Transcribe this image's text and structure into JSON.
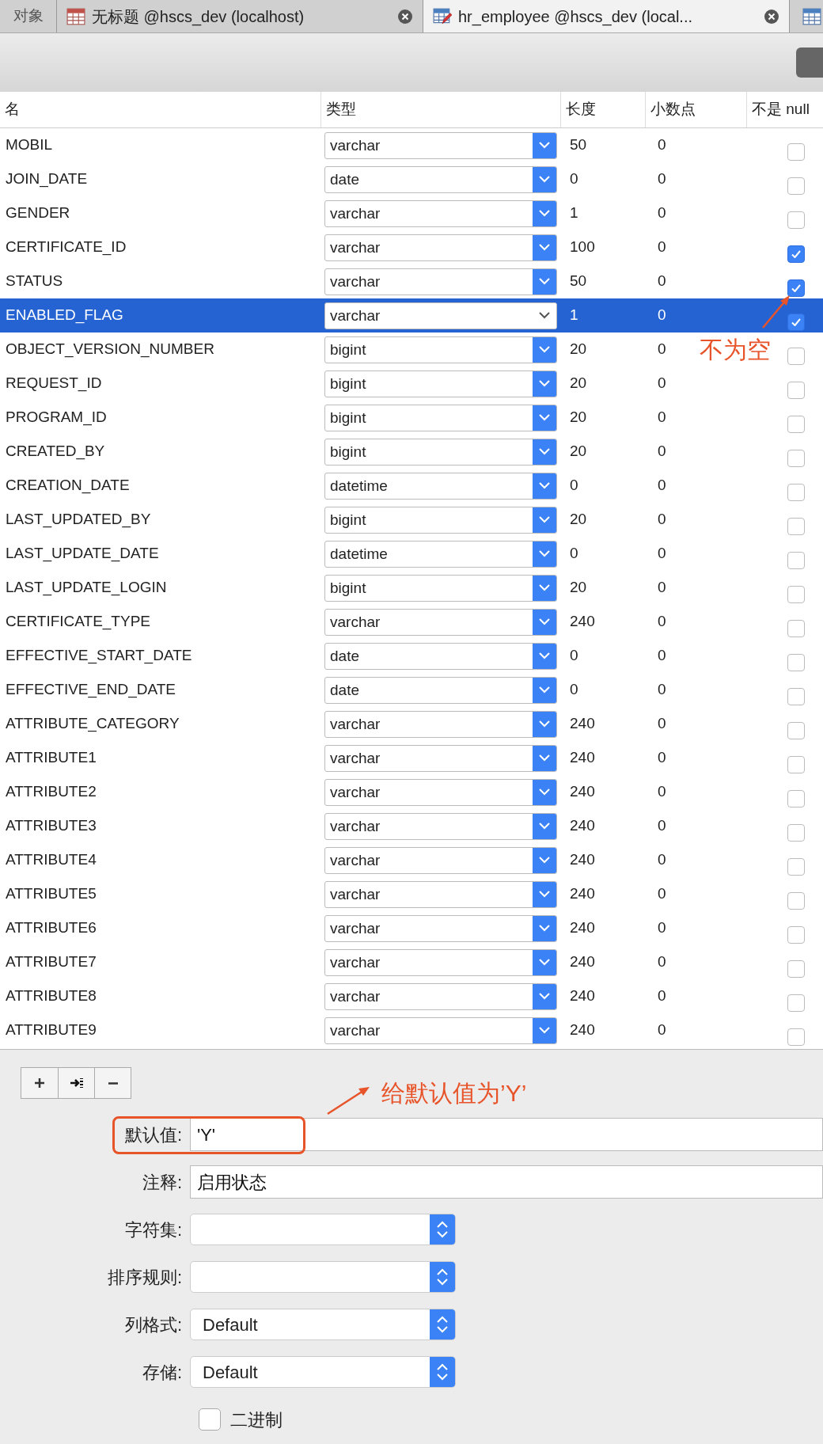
{
  "object_tab": {
    "label": "对象"
  },
  "tabs": [
    {
      "label": "无标题 @hscs_dev (localhost)",
      "selected": false
    },
    {
      "label": "hr_employee @hscs_dev (local...",
      "selected": true
    }
  ],
  "table": {
    "columns": [
      "名",
      "类型",
      "长度",
      "小数点",
      "不是 null"
    ],
    "rows": [
      {
        "name": "MOBIL",
        "type": "varchar",
        "length": "50",
        "decimals": "0",
        "not_null": false,
        "selected": false
      },
      {
        "name": "JOIN_DATE",
        "type": "date",
        "length": "0",
        "decimals": "0",
        "not_null": false,
        "selected": false
      },
      {
        "name": "GENDER",
        "type": "varchar",
        "length": "1",
        "decimals": "0",
        "not_null": false,
        "selected": false
      },
      {
        "name": "CERTIFICATE_ID",
        "type": "varchar",
        "length": "100",
        "decimals": "0",
        "not_null": true,
        "selected": false
      },
      {
        "name": "STATUS",
        "type": "varchar",
        "length": "50",
        "decimals": "0",
        "not_null": true,
        "selected": false
      },
      {
        "name": "ENABLED_FLAG",
        "type": "varchar",
        "length": "1",
        "decimals": "0",
        "not_null": true,
        "selected": true
      },
      {
        "name": "OBJECT_VERSION_NUMBER",
        "type": "bigint",
        "length": "20",
        "decimals": "0",
        "not_null": false,
        "selected": false
      },
      {
        "name": "REQUEST_ID",
        "type": "bigint",
        "length": "20",
        "decimals": "0",
        "not_null": false,
        "selected": false
      },
      {
        "name": "PROGRAM_ID",
        "type": "bigint",
        "length": "20",
        "decimals": "0",
        "not_null": false,
        "selected": false
      },
      {
        "name": "CREATED_BY",
        "type": "bigint",
        "length": "20",
        "decimals": "0",
        "not_null": false,
        "selected": false
      },
      {
        "name": "CREATION_DATE",
        "type": "datetime",
        "length": "0",
        "decimals": "0",
        "not_null": false,
        "selected": false
      },
      {
        "name": "LAST_UPDATED_BY",
        "type": "bigint",
        "length": "20",
        "decimals": "0",
        "not_null": false,
        "selected": false
      },
      {
        "name": "LAST_UPDATE_DATE",
        "type": "datetime",
        "length": "0",
        "decimals": "0",
        "not_null": false,
        "selected": false
      },
      {
        "name": "LAST_UPDATE_LOGIN",
        "type": "bigint",
        "length": "20",
        "decimals": "0",
        "not_null": false,
        "selected": false
      },
      {
        "name": "CERTIFICATE_TYPE",
        "type": "varchar",
        "length": "240",
        "decimals": "0",
        "not_null": false,
        "selected": false
      },
      {
        "name": "EFFECTIVE_START_DATE",
        "type": "date",
        "length": "0",
        "decimals": "0",
        "not_null": false,
        "selected": false
      },
      {
        "name": "EFFECTIVE_END_DATE",
        "type": "date",
        "length": "0",
        "decimals": "0",
        "not_null": false,
        "selected": false
      },
      {
        "name": "ATTRIBUTE_CATEGORY",
        "type": "varchar",
        "length": "240",
        "decimals": "0",
        "not_null": false,
        "selected": false
      },
      {
        "name": "ATTRIBUTE1",
        "type": "varchar",
        "length": "240",
        "decimals": "0",
        "not_null": false,
        "selected": false
      },
      {
        "name": "ATTRIBUTE2",
        "type": "varchar",
        "length": "240",
        "decimals": "0",
        "not_null": false,
        "selected": false
      },
      {
        "name": "ATTRIBUTE3",
        "type": "varchar",
        "length": "240",
        "decimals": "0",
        "not_null": false,
        "selected": false
      },
      {
        "name": "ATTRIBUTE4",
        "type": "varchar",
        "length": "240",
        "decimals": "0",
        "not_null": false,
        "selected": false
      },
      {
        "name": "ATTRIBUTE5",
        "type": "varchar",
        "length": "240",
        "decimals": "0",
        "not_null": false,
        "selected": false
      },
      {
        "name": "ATTRIBUTE6",
        "type": "varchar",
        "length": "240",
        "decimals": "0",
        "not_null": false,
        "selected": false
      },
      {
        "name": "ATTRIBUTE7",
        "type": "varchar",
        "length": "240",
        "decimals": "0",
        "not_null": false,
        "selected": false
      },
      {
        "name": "ATTRIBUTE8",
        "type": "varchar",
        "length": "240",
        "decimals": "0",
        "not_null": false,
        "selected": false
      },
      {
        "name": "ATTRIBUTE9",
        "type": "varchar",
        "length": "240",
        "decimals": "0",
        "not_null": false,
        "selected": false
      }
    ]
  },
  "properties": [
    {
      "label": "默认值:",
      "kind": "text",
      "value": "'Y'"
    },
    {
      "label": "注释:",
      "kind": "text",
      "value": "启用状态"
    },
    {
      "label": "字符集:",
      "kind": "select"
    },
    {
      "label": "排序规则:",
      "kind": "select"
    },
    {
      "label": "列格式:",
      "kind": "select",
      "value": "Default"
    },
    {
      "label": "存储:",
      "kind": "select",
      "value": "Default"
    }
  ],
  "binary": {
    "label": "二进制",
    "checked": false
  },
  "annotations": [
    {
      "text": "不为空"
    },
    {
      "text": "给默认值为’Y’"
    }
  ]
}
